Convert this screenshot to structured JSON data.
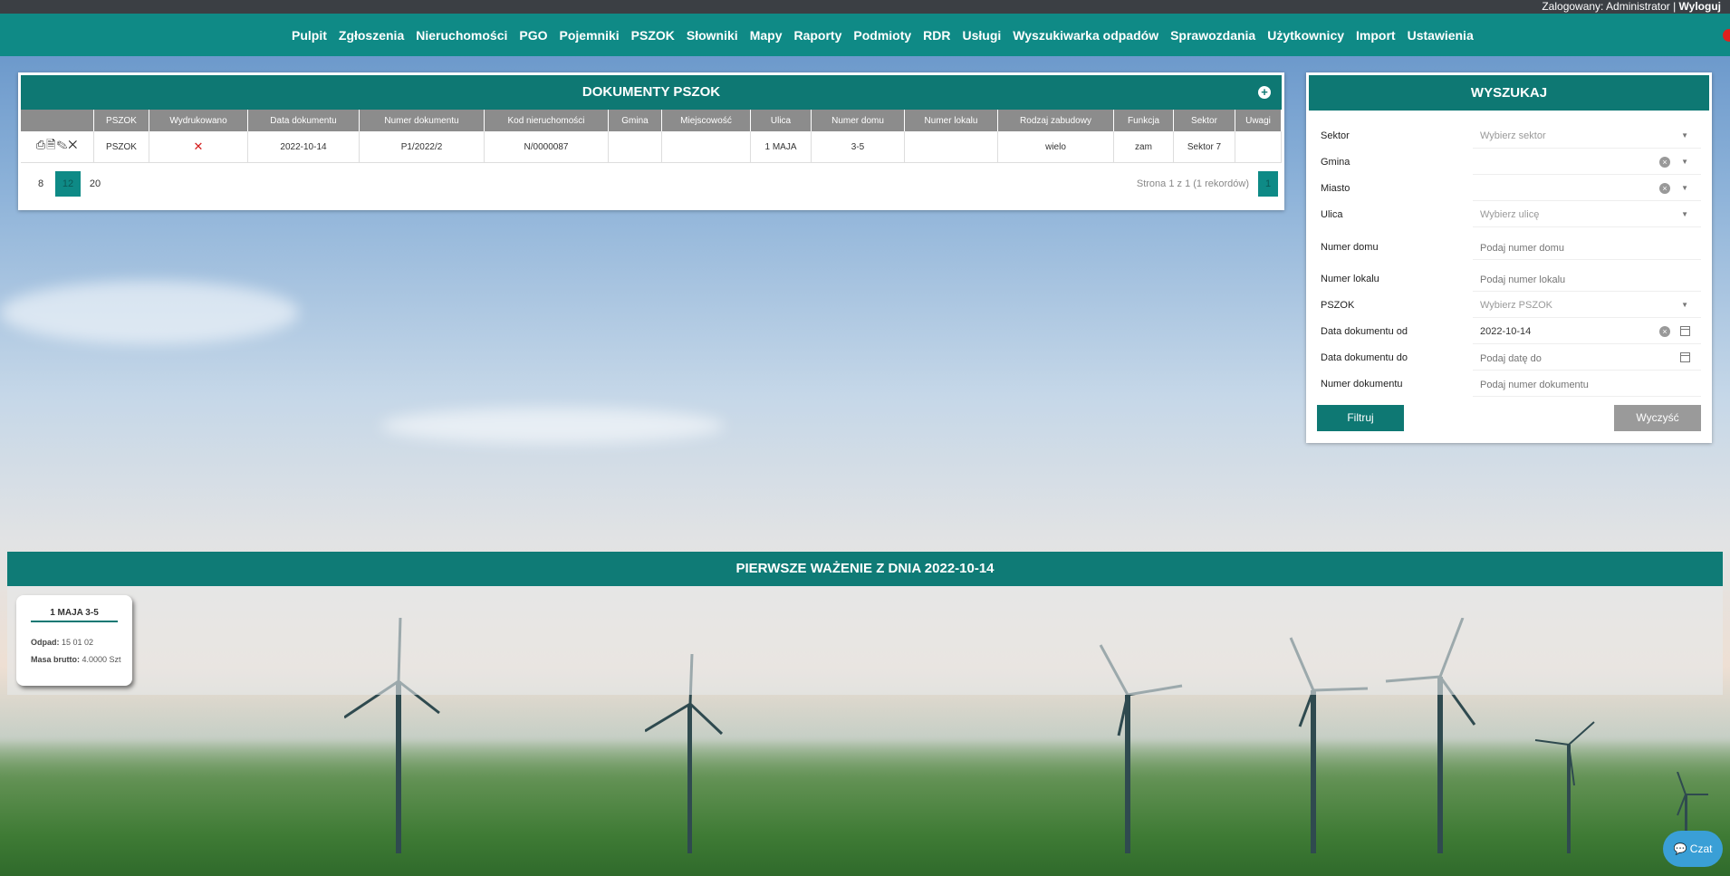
{
  "topbar": {
    "logged_label": "Zalogowany: Administrator |",
    "logout": "Wyloguj"
  },
  "nav": [
    "Pulpit",
    "Zgłoszenia",
    "Nieruchomości",
    "PGO",
    "Pojemniki",
    "PSZOK",
    "Słowniki",
    "Mapy",
    "Raporty",
    "Podmioty",
    "RDR",
    "Usługi",
    "Wyszukiwarka odpadów",
    "Sprawozdania",
    "Użytkownicy",
    "Import",
    "Ustawienia"
  ],
  "docs": {
    "title": "DOKUMENTY PSZOK",
    "columns": [
      "",
      "PSZOK",
      "Wydrukowano",
      "Data dokumentu",
      "Numer dokumentu",
      "Kod nieruchomości",
      "Gmina",
      "Miejscowość",
      "Ulica",
      "Numer domu",
      "Numer lokalu",
      "Rodzaj zabudowy",
      "Funkcja",
      "Sektor",
      "Uwagi"
    ],
    "rows": [
      {
        "pszok": "PSZOK",
        "printed": "✕",
        "date": "2022-10-14",
        "number": "P1/2022/2",
        "code": "N/0000087",
        "gmina": "",
        "town": "",
        "street": "1 MAJA",
        "house": "3-5",
        "flat": "",
        "build": "wielo",
        "func": "zam",
        "sector": "Sektor 7",
        "notes": ""
      }
    ],
    "page_sizes": [
      "8",
      "12",
      "20"
    ],
    "active_page_size": "12",
    "page_info": "Strona 1 z 1 (1 rekordów)",
    "current_page": "1"
  },
  "search": {
    "title": "WYSZUKAJ",
    "fields": {
      "sector": {
        "label": "Sektor",
        "placeholder": "Wybierz sektor"
      },
      "gmina": {
        "label": "Gmina",
        "value": ""
      },
      "city": {
        "label": "Miasto",
        "value": ""
      },
      "street": {
        "label": "Ulica",
        "placeholder": "Wybierz ulicę"
      },
      "house": {
        "label": "Numer domu",
        "placeholder": "Podaj numer domu"
      },
      "flat": {
        "label": "Numer lokalu",
        "placeholder": "Podaj numer lokalu"
      },
      "pszok": {
        "label": "PSZOK",
        "placeholder": "Wybierz PSZOK"
      },
      "date_from": {
        "label": "Data dokumentu od",
        "value": "2022-10-14"
      },
      "date_to": {
        "label": "Data dokumentu do",
        "placeholder": "Podaj datę do"
      },
      "doc_number": {
        "label": "Numer dokumentu",
        "placeholder": "Podaj numer dokumentu"
      }
    },
    "filter_btn": "Filtruj",
    "clear_btn": "Wyczyść"
  },
  "weighing": {
    "title": "PIERWSZE WAŻENIE Z DNIA 2022-10-14",
    "card": {
      "title": "1 MAJA 3-5",
      "waste_label": "Odpad:",
      "waste_value": "15 01 02",
      "mass_label": "Masa brutto:",
      "mass_value": "4.0000 Szt"
    }
  },
  "chat": "Czat"
}
